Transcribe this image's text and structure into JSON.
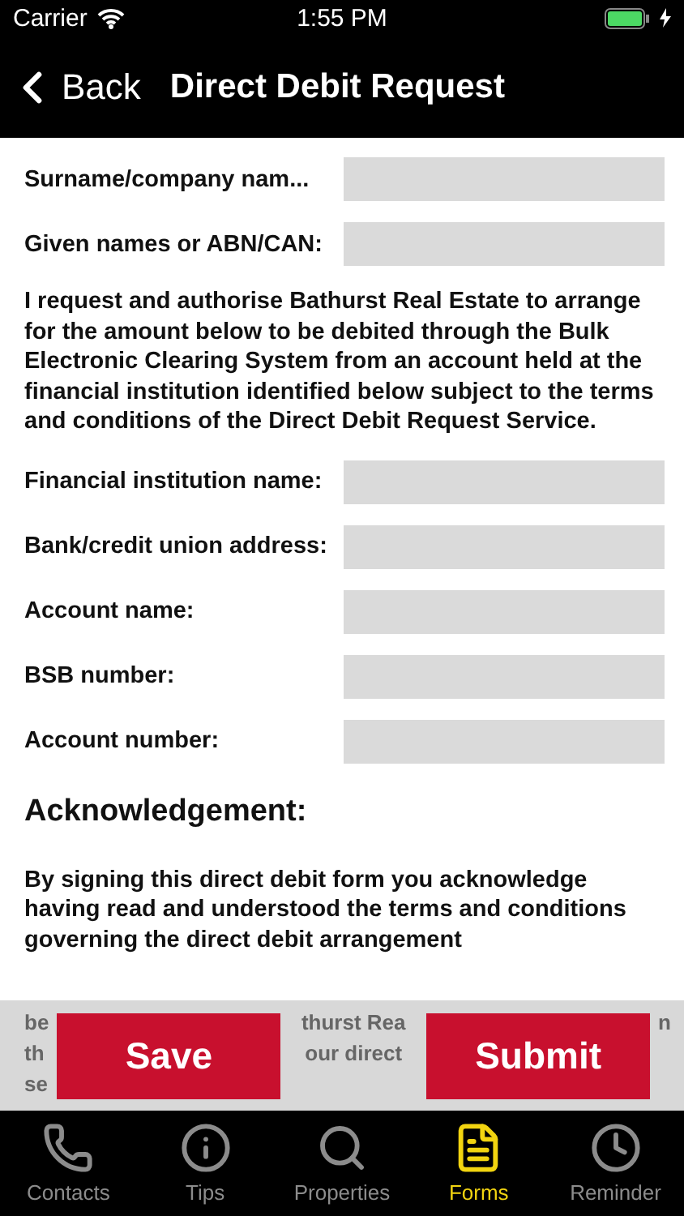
{
  "status_bar": {
    "carrier": "Carrier",
    "time": "1:55 PM",
    "charging": true
  },
  "nav": {
    "back": "Back",
    "title": "Direct Debit Request"
  },
  "fields_top": [
    {
      "label": "Surname/company nam..."
    },
    {
      "label": "Given names or ABN/CAN:"
    }
  ],
  "authorisation": "I request and authorise Bathurst Real Estate to arrange for the amount below to be debited through the Bulk Electronic Clearing System from an account held at the financial institution identified below subject to the terms and conditions of the Direct Debit Request Service.",
  "fields_bank": [
    {
      "label": "Financial institution name:"
    },
    {
      "label": "Bank/credit union address:"
    },
    {
      "label": "Account name:"
    },
    {
      "label": "BSB number:"
    },
    {
      "label": "Account number:"
    }
  ],
  "acknowledgement": {
    "heading": "Acknowledgement:",
    "text": "By signing this direct debit form you acknowledge having read and understood the terms and conditions governing the direct debit arrangement",
    "covered_columns": [
      [
        "be",
        "th",
        "se"
      ],
      [
        "thurst Rea",
        "our direct"
      ],
      [
        "n"
      ]
    ]
  },
  "actions": [
    "Save",
    "Submit"
  ],
  "tabs": [
    {
      "label": "Contacts",
      "selected": false
    },
    {
      "label": "Tips",
      "selected": false
    },
    {
      "label": "Properties",
      "selected": false
    },
    {
      "label": "Forms",
      "selected": true
    },
    {
      "label": "Reminder",
      "selected": false
    }
  ]
}
